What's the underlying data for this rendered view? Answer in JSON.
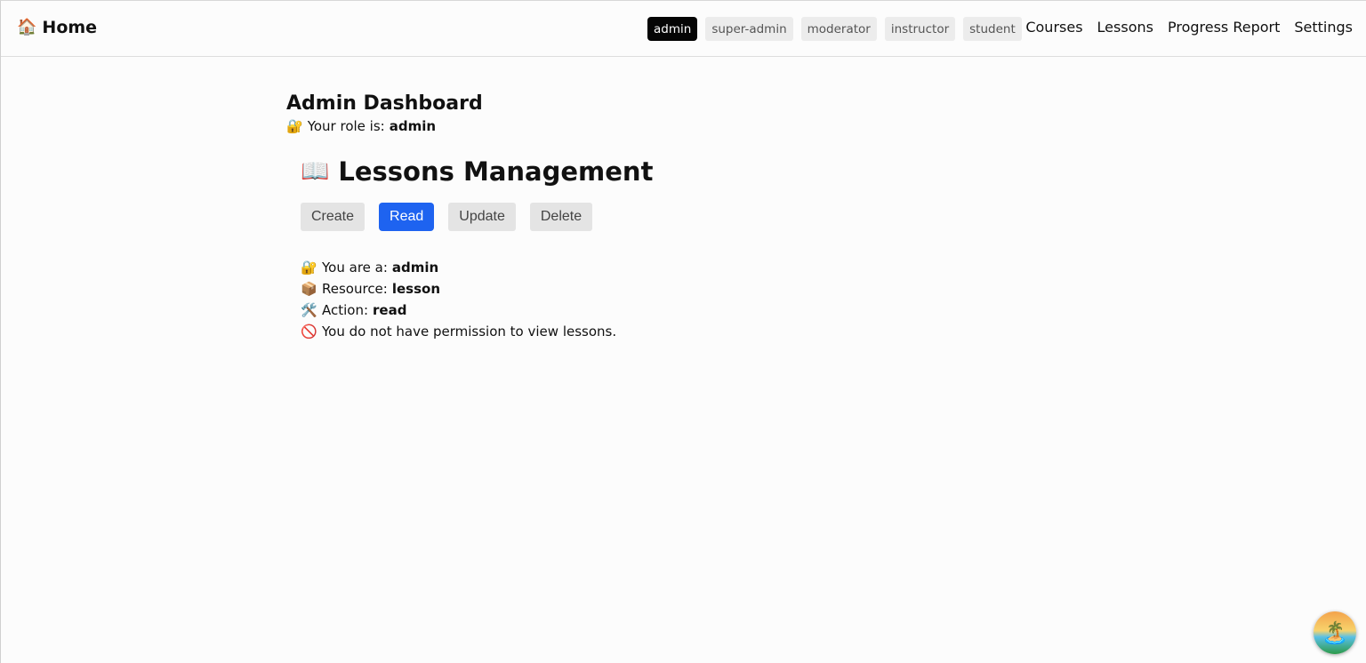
{
  "nav": {
    "home_icon": "🏠",
    "home_label": "Home",
    "roles": [
      {
        "label": "admin",
        "active": true
      },
      {
        "label": "super-admin",
        "active": false
      },
      {
        "label": "moderator",
        "active": false
      },
      {
        "label": "instructor",
        "active": false
      },
      {
        "label": "student",
        "active": false
      }
    ],
    "links": [
      "Courses",
      "Lessons",
      "Progress Report",
      "Settings"
    ]
  },
  "dashboard": {
    "title": "Admin Dashboard",
    "role_icon": "🔐",
    "role_prefix": "Your role is:",
    "role_value": "admin"
  },
  "panel": {
    "icon": "📖",
    "title": "Lessons Management",
    "actions": [
      {
        "label": "Create",
        "active": false
      },
      {
        "label": "Read",
        "active": true
      },
      {
        "label": "Update",
        "active": false
      },
      {
        "label": "Delete",
        "active": false
      }
    ],
    "info": {
      "you_icon": "🔐",
      "you_label": "You are a:",
      "you_value": "admin",
      "resource_icon": "📦",
      "resource_label": "Resource:",
      "resource_value": "lesson",
      "action_icon": "🛠️",
      "action_label": "Action:",
      "action_value": "read",
      "denied_icon": "🚫",
      "denied_text": "You do not have permission to view lessons."
    }
  },
  "widget": {
    "icon": "🏝️"
  },
  "colors": {
    "active_role": "#050505",
    "active_action": "#1e63f0"
  }
}
